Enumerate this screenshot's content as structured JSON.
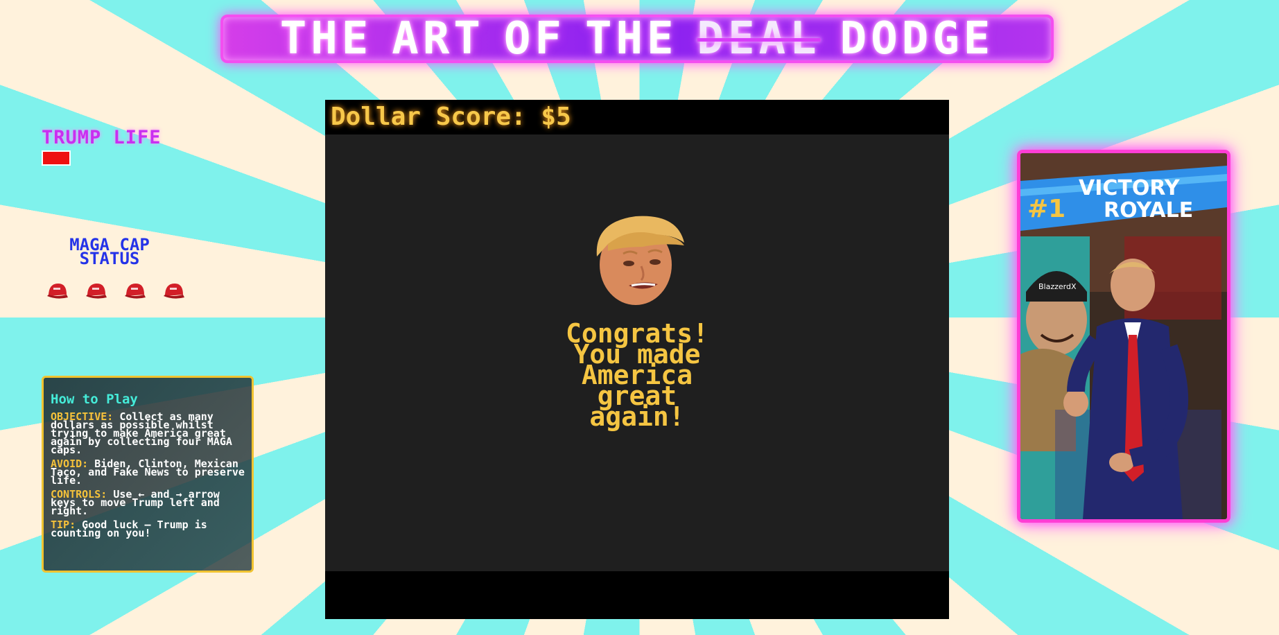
{
  "title": {
    "word1": "THE",
    "word2": "ART",
    "word3": "OF",
    "word4": "THE",
    "struck_word": "DEAL",
    "word5": "DODGE"
  },
  "life": {
    "label": "TRUMP LIFE",
    "level": 0.2,
    "bar_color": "#ee1111"
  },
  "maga": {
    "label": "MAGA CAP\nSTATUS",
    "caps": [
      {
        "icon": "maga-cap-icon",
        "collected": true
      },
      {
        "icon": "maga-cap-icon",
        "collected": true
      },
      {
        "icon": "maga-cap-icon",
        "collected": true
      },
      {
        "icon": "maga-cap-icon",
        "collected": true
      }
    ]
  },
  "howto": {
    "heading": "How to Play",
    "objective_key": "OBJECTIVE:",
    "objective_text": "Collect as many dollars as possible whilst trying to make America great again by collecting four MAGA caps.",
    "avoid_key": "AVOID:",
    "avoid_text": "Biden, Clinton, Mexican Taco, and Fake News to preserve life.",
    "controls_key": "CONTROLS:",
    "controls_text": "Use ← and → arrow keys to move Trump left and right.",
    "tip_key": "TIP:",
    "tip_text": "Good luck — Trump is counting on you!"
  },
  "game": {
    "score_text": "Dollar Score: $5",
    "message": "Congrats!\nYou made\nAmerica\ngreat\nagain!",
    "player_icon": "trump-head-sprite"
  },
  "ad": {
    "banner_rank": "#1",
    "banner_line1": "VICTORY",
    "banner_line2": "ROYALE",
    "hat_text": "BlazzerdX"
  },
  "colors": {
    "accent_magenta": "#ff3ed4",
    "score_gold": "#f7c84a",
    "message_gold": "#f5c542",
    "teal_heading": "#45ecd9"
  }
}
